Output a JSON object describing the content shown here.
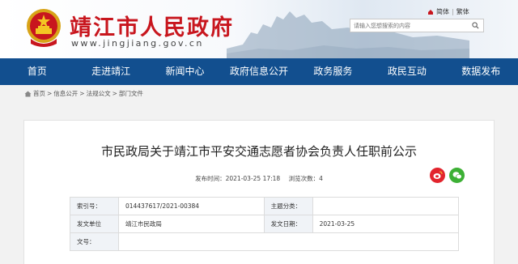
{
  "header": {
    "site_title": "靖江市人民政府",
    "site_url": "www.jingjiang.gov.cn",
    "lang_simplified": "简体",
    "lang_traditional": "繁体",
    "search_placeholder": "请输入您想搜索的内容"
  },
  "nav": {
    "items": [
      "首页",
      "走进靖江",
      "新闻中心",
      "政府信息公开",
      "政务服务",
      "政民互动",
      "数据发布"
    ]
  },
  "breadcrumb": {
    "items": [
      "首页",
      "信息公开",
      "法规公文",
      "部门文件"
    ],
    "separator": ">"
  },
  "article": {
    "title": "市民政局关于靖江市平安交通志愿者协会负责人任职前公示",
    "publish_label": "发布时间：",
    "publish_time": "2021-03-25 17:18",
    "views_label": "浏览次数：",
    "views": "4"
  },
  "info_table": {
    "index_label": "索引号：",
    "index_value": "014437617/2021-00384",
    "topic_label": "主题分类：",
    "topic_value": "",
    "org_label": "发文单位",
    "org_value": "靖江市民政局",
    "date_label": "发文日期：",
    "date_value": "2021-03-25",
    "docno_label": "文号：",
    "docno_value": ""
  },
  "colors": {
    "brand_red": "#c8161e",
    "nav_blue": "#124f8f",
    "weibo_red": "#e2242d",
    "wechat_green": "#3db035"
  }
}
